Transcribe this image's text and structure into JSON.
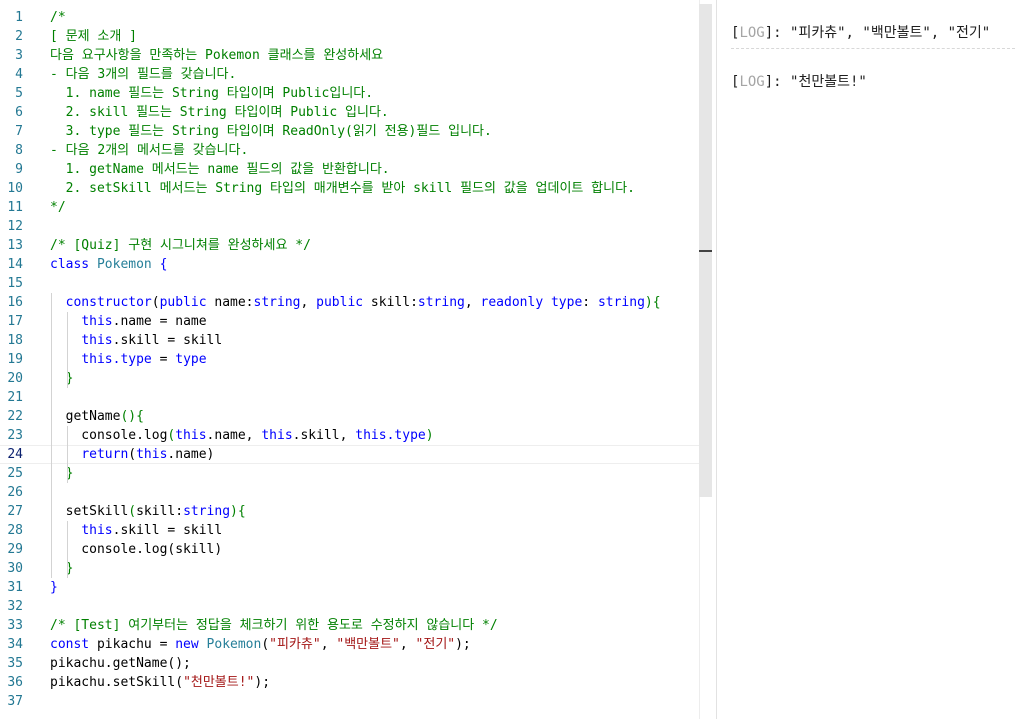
{
  "editor": {
    "active_line": 24,
    "line_numbers": [
      "1",
      "2",
      "3",
      "4",
      "5",
      "6",
      "7",
      "8",
      "9",
      "10",
      "11",
      "12",
      "13",
      "14",
      "15",
      "16",
      "17",
      "18",
      "19",
      "20",
      "21",
      "22",
      "23",
      "24",
      "25",
      "26",
      "27",
      "28",
      "29",
      "30",
      "31",
      "32",
      "33",
      "34",
      "35",
      "36",
      "37"
    ],
    "tokens": [
      [
        {
          "t": "/*",
          "c": "c"
        }
      ],
      [
        {
          "t": "[ 문제 소개 ]",
          "c": "c"
        }
      ],
      [
        {
          "t": "다음 요구사항을 만족하는 Pokemon 클래스를 완성하세요",
          "c": "c"
        }
      ],
      [
        {
          "t": "- 다음 3개의 필드를 갖습니다.",
          "c": "c"
        }
      ],
      [
        {
          "t": "  1. name 필드는 String 타입이며 Public입니다.",
          "c": "c"
        }
      ],
      [
        {
          "t": "  2. skill 필드는 String 타입이며 Public 입니다.",
          "c": "c"
        }
      ],
      [
        {
          "t": "  3. type 필드는 String 타입이며 ReadOnly(읽기 전용)필드 입니다.",
          "c": "c"
        }
      ],
      [
        {
          "t": "- 다음 2개의 메서드를 갖습니다.",
          "c": "c"
        }
      ],
      [
        {
          "t": "  1. getName 메서드는 name 필드의 값을 반환합니다.",
          "c": "c"
        }
      ],
      [
        {
          "t": "  2. setSkill 메서드는 String 타입의 매개변수를 받아 skill 필드의 값을 업데이트 합니다.",
          "c": "c"
        }
      ],
      [
        {
          "t": "*/",
          "c": "c"
        }
      ],
      [],
      [
        {
          "t": "/* [Quiz] 구현 시그니쳐를 완성하세요 */",
          "c": "c"
        }
      ],
      [
        {
          "t": "class",
          "c": "k"
        },
        {
          "t": " "
        },
        {
          "t": "Pokemon",
          "c": "t"
        },
        {
          "t": " {",
          "c": "k"
        }
      ],
      [],
      [
        {
          "t": "  "
        },
        {
          "t": "constructor",
          "c": "k"
        },
        {
          "t": "("
        },
        {
          "t": "public",
          "c": "k"
        },
        {
          "t": " name:"
        },
        {
          "t": "string",
          "c": "k"
        },
        {
          "t": ", "
        },
        {
          "t": "public",
          "c": "k"
        },
        {
          "t": " skill:"
        },
        {
          "t": "string",
          "c": "k"
        },
        {
          "t": ", "
        },
        {
          "t": "readonly",
          "c": "k"
        },
        {
          "t": " "
        },
        {
          "t": "type",
          "c": "k"
        },
        {
          "t": ": "
        },
        {
          "t": "string",
          "c": "k"
        },
        {
          "t": "){",
          "c": "c"
        }
      ],
      [
        {
          "t": "    "
        },
        {
          "t": "this",
          "c": "k"
        },
        {
          "t": ".name = name"
        }
      ],
      [
        {
          "t": "    "
        },
        {
          "t": "this",
          "c": "k"
        },
        {
          "t": ".skill = skill"
        }
      ],
      [
        {
          "t": "    "
        },
        {
          "t": "this",
          "c": "k"
        },
        {
          "t": ".type",
          "c": "k"
        },
        {
          "t": " = "
        },
        {
          "t": "type",
          "c": "k"
        }
      ],
      [
        {
          "t": "  }",
          "c": "c"
        }
      ],
      [],
      [
        {
          "t": "  getName"
        },
        {
          "t": "(){",
          "c": "c"
        }
      ],
      [
        {
          "t": "    console.log"
        },
        {
          "t": "(",
          "c": "c"
        },
        {
          "t": "this",
          "c": "k"
        },
        {
          "t": ".name, "
        },
        {
          "t": "this",
          "c": "k"
        },
        {
          "t": ".skill, "
        },
        {
          "t": "this",
          "c": "k"
        },
        {
          "t": ".type",
          "c": "k"
        },
        {
          "t": ")",
          "c": "c"
        }
      ],
      [
        {
          "t": "    "
        },
        {
          "t": "return",
          "c": "k"
        },
        {
          "t": "("
        },
        {
          "t": "this",
          "c": "k"
        },
        {
          "t": ".name)"
        }
      ],
      [
        {
          "t": "  }",
          "c": "c"
        }
      ],
      [],
      [
        {
          "t": "  setSkill"
        },
        {
          "t": "(",
          "c": "c"
        },
        {
          "t": "skill:"
        },
        {
          "t": "string",
          "c": "k"
        },
        {
          "t": "){",
          "c": "c"
        }
      ],
      [
        {
          "t": "    "
        },
        {
          "t": "this",
          "c": "k"
        },
        {
          "t": ".skill = skill"
        }
      ],
      [
        {
          "t": "    console.log"
        },
        {
          "t": "("
        },
        {
          "t": "skill"
        },
        {
          "t": ")"
        }
      ],
      [
        {
          "t": "  }",
          "c": "c"
        }
      ],
      [
        {
          "t": "}",
          "k": 1,
          "c": "k"
        }
      ],
      [],
      [
        {
          "t": "/* [Test] 여기부터는 정답을 체크하기 위한 용도로 수정하지 않습니다 */",
          "c": "c"
        }
      ],
      [
        {
          "t": "const",
          "c": "k"
        },
        {
          "t": " pikachu = "
        },
        {
          "t": "new",
          "c": "k"
        },
        {
          "t": " "
        },
        {
          "t": "Pokemon",
          "c": "t"
        },
        {
          "t": "("
        },
        {
          "t": "\"피카츄\"",
          "c": "s"
        },
        {
          "t": ", "
        },
        {
          "t": "\"백만볼트\"",
          "c": "s"
        },
        {
          "t": ", "
        },
        {
          "t": "\"전기\"",
          "c": "s"
        },
        {
          "t": ");"
        }
      ],
      [
        {
          "t": "pikachu.getName();"
        }
      ],
      [
        {
          "t": "pikachu.setSkill("
        },
        {
          "t": "\"천만볼트!\"",
          "c": "s"
        },
        {
          "t": ");"
        }
      ],
      []
    ]
  },
  "console": {
    "logs": [
      {
        "tag": "LOG",
        "text": ": \"피카츄\",  \"백만볼트\", \"전기\""
      },
      {
        "tag": "LOG",
        "text": ": \"천만볼트!\""
      }
    ]
  }
}
